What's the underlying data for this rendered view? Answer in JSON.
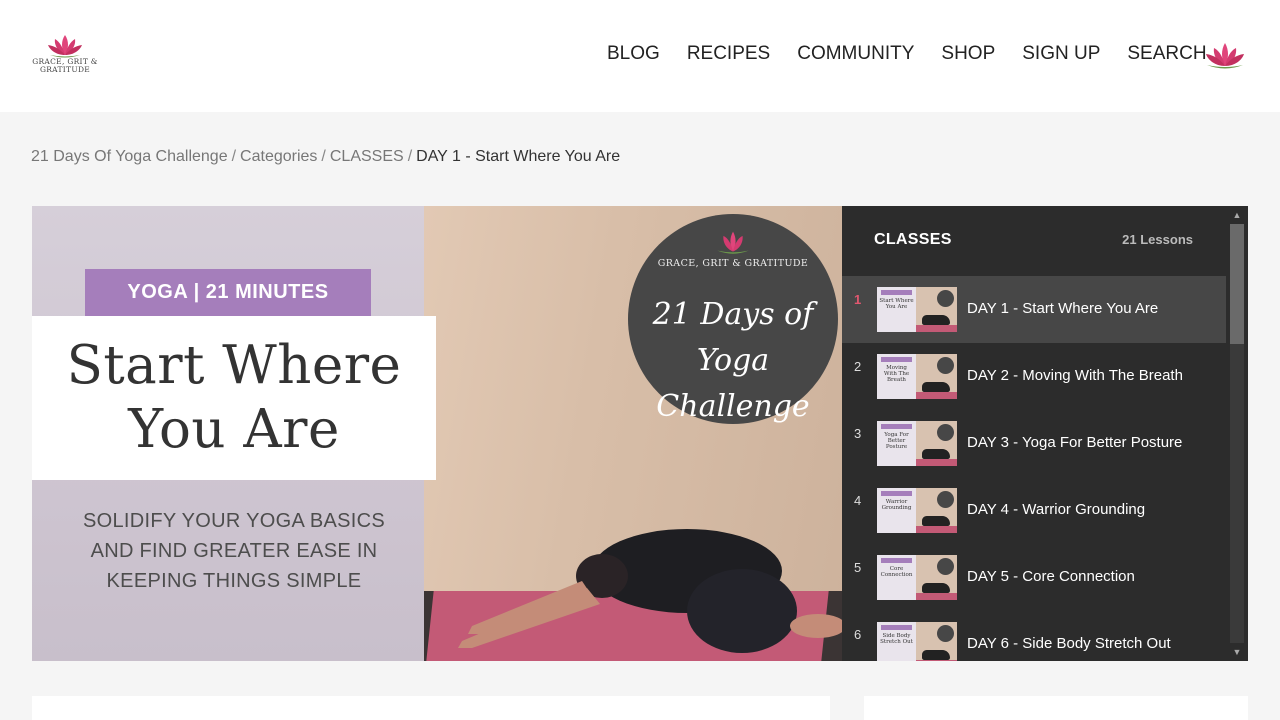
{
  "header": {
    "logo_text": "GRACE, GRIT & GRATITUDE",
    "nav": [
      "BLOG",
      "RECIPES",
      "COMMUNITY",
      "SHOP",
      "SIGN UP",
      "SEARCH"
    ],
    "accent_color": "#e0457b"
  },
  "breadcrumb": {
    "links": [
      "21 Days Of Yoga Challenge",
      "Categories",
      "CLASSES"
    ],
    "current": "DAY 1 - Start Where You Are",
    "separator": "/"
  },
  "video": {
    "badge": "YOGA |  21 MINUTES",
    "title_line1": "Start Where",
    "title_line2": "You Are",
    "subtitle": "SOLIDIFY YOUR YOGA BASICS AND FIND GREATER EASE IN KEEPING THINGS SIMPLE",
    "circle_brand": "GRACE, GRIT & GRATITUDE",
    "circle_title_line1": "21 Days of",
    "circle_title_line2": "Yoga Challenge",
    "badge_color": "#a57ebb"
  },
  "playlist": {
    "title": "CLASSES",
    "count": "21 Lessons",
    "active_color": "#e0576f",
    "items": [
      {
        "num": "1",
        "label": "DAY 1 - Start Where You Are",
        "thumb": "Start Where You Are"
      },
      {
        "num": "2",
        "label": "DAY 2 - Moving With The Breath",
        "thumb": "Moving With The Breath"
      },
      {
        "num": "3",
        "label": "DAY 3 - Yoga For Better Posture",
        "thumb": "Yoga For Better Posture"
      },
      {
        "num": "4",
        "label": "DAY 4 - Warrior Grounding",
        "thumb": "Warrior Grounding"
      },
      {
        "num": "5",
        "label": "DAY 5 - Core Connection",
        "thumb": "Core Connection"
      },
      {
        "num": "6",
        "label": "DAY 6 - Side Body Stretch Out",
        "thumb": "Side Body Stretch Out"
      }
    ]
  }
}
